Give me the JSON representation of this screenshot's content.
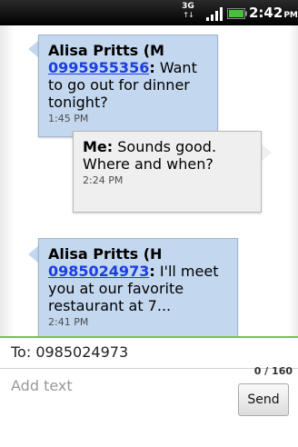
{
  "status_bar": {
    "network_type": "3G",
    "time": "2:42",
    "ampm": "PM",
    "icons": [
      "network-3g-icon",
      "signal-icon",
      "battery-icon"
    ],
    "battery_color": "#46c23a"
  },
  "messages": [
    {
      "direction": "received",
      "sender": "Alisa Pritts (M",
      "phone": "0995955356",
      "separator": ":",
      "text": " Want to go out for dinner tonight?",
      "time": "1:45 PM"
    },
    {
      "direction": "sent",
      "sender": "Me:",
      "text": " Sounds good. Where and when?",
      "time": "2:24 PM"
    },
    {
      "direction": "received",
      "sender": "Alisa Pritts (H",
      "phone": "0985024973",
      "separator": ":",
      "text": " I'll meet you at our favorite restaurant at 7...",
      "time": "2:41 PM"
    }
  ],
  "compose": {
    "to_value": "To: 0985024973",
    "placeholder": "Add text",
    "counter": "0 / 160",
    "send_label": "Send"
  },
  "colors": {
    "received_bubble": "#c3d7ef",
    "sent_bubble": "#efefef",
    "link": "#1a3ee0",
    "compose_accent": "#7cc045"
  }
}
